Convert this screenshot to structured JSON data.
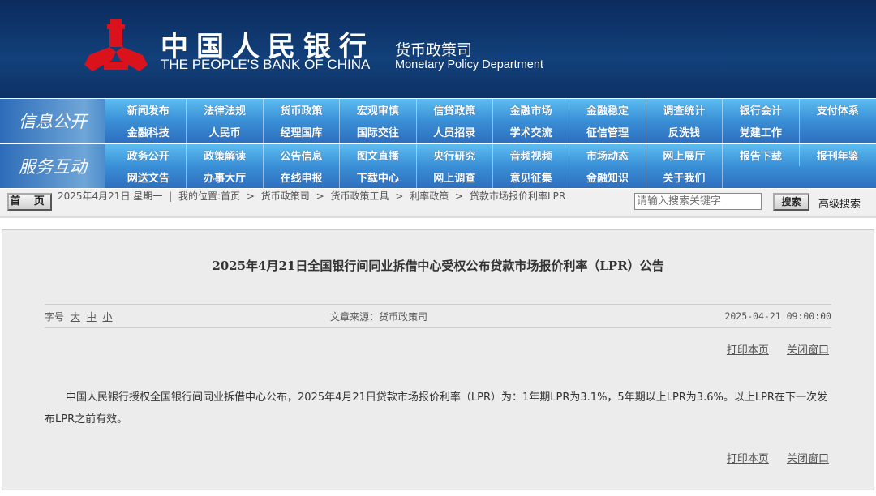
{
  "header": {
    "title_cn": "中国人民银行",
    "title_en": "THE PEOPLE'S BANK OF CHINA",
    "dept_cn": "货币政策司",
    "dept_en": "Monetary Policy Department",
    "logo": "pboc-logo"
  },
  "nav": {
    "band1": {
      "label": "信息公开",
      "items": [
        "新闻发布",
        "法律法规",
        "货币政策",
        "宏观审慎",
        "信贷政策",
        "金融市场",
        "金融稳定",
        "调查统计",
        "银行会计",
        "支付体系",
        "金融科技",
        "人民币",
        "经理国库",
        "国际交往",
        "人员招录",
        "学术交流",
        "征信管理",
        "反洗钱",
        "党建工作"
      ]
    },
    "band2": {
      "label": "服务互动",
      "items": [
        "政务公开",
        "政策解读",
        "公告信息",
        "图文直播",
        "央行研究",
        "音频视频",
        "市场动态",
        "网上展厅",
        "报告下载",
        "报刊年鉴",
        "网送文告",
        "办事大厅",
        "在线申报",
        "下载中心",
        "网上调查",
        "意见征集",
        "金融知识",
        "关于我们"
      ]
    }
  },
  "breadcrumb": {
    "home_button": "首 页",
    "date": "2025年4月21日 星期一",
    "sep": "|",
    "location_label": "我的位置:首页",
    "items": [
      "货币政策司",
      "货币政策工具",
      "利率政策",
      "贷款市场报价利率LPR"
    ],
    "arrow": ">"
  },
  "search": {
    "placeholder": "请输入搜索关键字",
    "button": "搜索",
    "advanced": "高级搜索"
  },
  "article": {
    "title": "2025年4月21日全国银行间同业拆借中心受权公布贷款市场报价利率（LPR）公告",
    "font_size_label": "字号",
    "font_sizes": [
      "大",
      "中",
      "小"
    ],
    "source": "文章来源：货币政策司",
    "datetime": "2025-04-21 09:00:00",
    "print": "打印本页",
    "close": "关闭窗口",
    "body": "中国人民银行授权全国银行间同业拆借中心公布，2025年4月21日贷款市场报价利率（LPR）为：1年期LPR为3.1%，5年期以上LPR为3.6%。以上LPR在下一次发布LPR之前有效。"
  }
}
